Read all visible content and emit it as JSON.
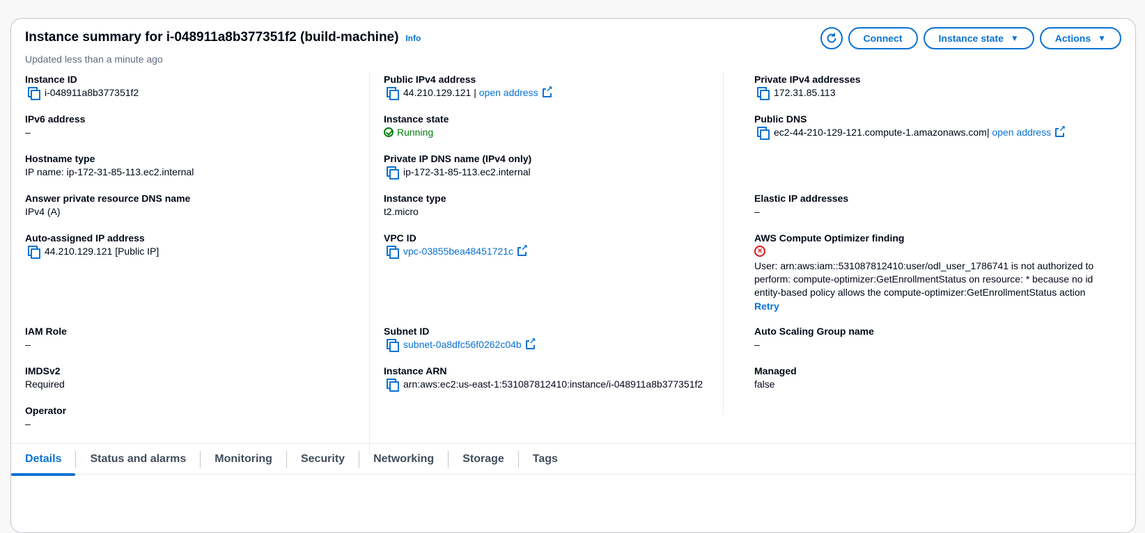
{
  "header": {
    "title": "Instance summary for i-048911a8b377351f2 (build-machine)",
    "info": "Info",
    "updated": "Updated less than a minute ago"
  },
  "buttons": {
    "refresh_icon": "refresh-icon",
    "connect": "Connect",
    "instance_state": "Instance state",
    "actions": "Actions"
  },
  "col1": {
    "instance_id": {
      "label": "Instance ID",
      "value": "i-048911a8b377351f2"
    },
    "ipv6": {
      "label": "IPv6 address",
      "value": "–"
    },
    "hostname_type": {
      "label": "Hostname type",
      "value": "IP name: ip-172-31-85-113.ec2.internal"
    },
    "answer_dns": {
      "label": "Answer private resource DNS name",
      "value": "IPv4 (A)"
    },
    "auto_ip": {
      "label": "Auto-assigned IP address",
      "value": "44.210.129.121 [Public IP]"
    },
    "iam_role": {
      "label": "IAM Role",
      "value": "–"
    },
    "imdsv2": {
      "label": "IMDSv2",
      "value": "Required"
    },
    "operator": {
      "label": "Operator",
      "value": "–"
    }
  },
  "col2": {
    "public_ipv4": {
      "label": "Public IPv4 address",
      "value": "44.210.129.121",
      "sep": "|",
      "link": "open address"
    },
    "instance_state": {
      "label": "Instance state",
      "value": "Running"
    },
    "private_dns": {
      "label": "Private IP DNS name (IPv4 only)",
      "value": "ip-172-31-85-113.ec2.internal"
    },
    "instance_type": {
      "label": "Instance type",
      "value": "t2.micro"
    },
    "vpc_id": {
      "label": "VPC ID",
      "value": "vpc-03855bea48451721c"
    },
    "subnet_id": {
      "label": "Subnet ID",
      "value": "subnet-0a8dfc56f0262c04b"
    },
    "arn": {
      "label": "Instance ARN",
      "value": "arn:aws:ec2:us-east-1:531087812410:instance/i-048911a8b377351f2"
    }
  },
  "col3": {
    "private_ipv4": {
      "label": "Private IPv4 addresses",
      "value": "172.31.85.113"
    },
    "public_dns": {
      "label": "Public DNS",
      "value": "ec2-44-210-129-121.compute-1.amazonaws.com",
      "sep": "|",
      "link": "open address"
    },
    "elastic_ip": {
      "label": "Elastic IP addresses",
      "value": "–"
    },
    "optimizer": {
      "label": "AWS Compute Optimizer finding",
      "error": "User: arn:aws:iam::531087812410:user/odl_user_1786741 is not authorized to perform: compute-optimizer:GetEnrollmentStatus on resource: * because no identity-based policy allows the compute-optimizer:GetEnrollmentStatus action",
      "retry": "Retry"
    },
    "asg": {
      "label": "Auto Scaling Group name",
      "value": "–"
    },
    "managed": {
      "label": "Managed",
      "value": "false"
    }
  },
  "tabs": [
    "Details",
    "Status and alarms",
    "Monitoring",
    "Security",
    "Networking",
    "Storage",
    "Tags"
  ],
  "colors": {
    "accent": "#0972d3",
    "success": "#037f0c",
    "error": "#d91515"
  }
}
